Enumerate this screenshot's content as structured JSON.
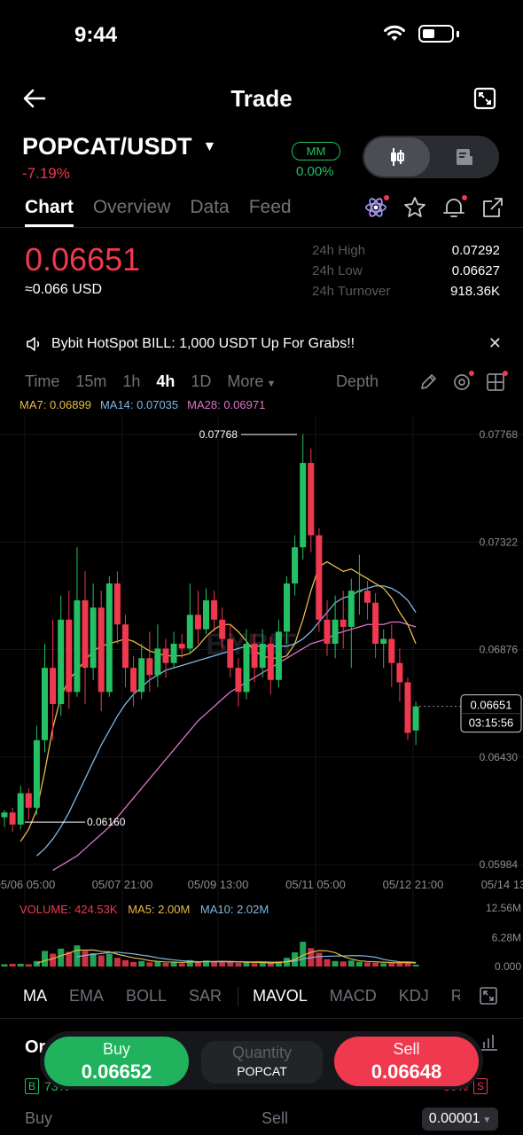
{
  "status_bar": {
    "time": "9:44"
  },
  "header": {
    "title": "Trade"
  },
  "pair": {
    "symbol": "POPCAT/USDT",
    "change": "-7.19%",
    "mm_label": "MM",
    "mm_value": "0.00%"
  },
  "tabs": [
    "Chart",
    "Overview",
    "Data",
    "Feed"
  ],
  "price": {
    "last": "0.06651",
    "usd": "≈0.066 USD"
  },
  "stats": [
    {
      "label": "24h High",
      "value": "0.07292"
    },
    {
      "label": "24h Low",
      "value": "0.06627"
    },
    {
      "label": "24h Turnover",
      "value": "918.36K"
    }
  ],
  "announcement": {
    "text": "Bybit HotSpot BILL: 1,000 USDT Up For Grabs!!"
  },
  "timeframes": {
    "items": [
      "Time",
      "15m",
      "1h",
      "4h",
      "1D"
    ],
    "active": "4h",
    "more": "More",
    "depth": "Depth"
  },
  "ma_legend": {
    "ma7": "MA7: 0.06899",
    "ma14": "MA14: 0.07035",
    "ma28": "MA28: 0.06971"
  },
  "colors": {
    "up": "#24c064",
    "down": "#f0394e",
    "ma7": "#e9b949",
    "ma14": "#7fb8e6",
    "ma28": "#dc74c7"
  },
  "chart_data": {
    "type": "candlestick",
    "y_labels": [
      "0.07768",
      "0.07322",
      "0.06876",
      "0.06430",
      "0.05984"
    ],
    "ylim": [
      0.05984,
      0.07768
    ],
    "x_labels": [
      "05/06 05:00",
      "05/07 21:00",
      "05/09 13:00",
      "05/11 05:00",
      "05/12 21:00",
      "05/14 13"
    ],
    "annotations": {
      "high": "0.07768",
      "low": "0.06160"
    },
    "current": {
      "price": "0.06651",
      "countdown": "03:15:56"
    },
    "candles": [
      [
        0.0618,
        0.062,
        0.0614,
        0.0621
      ],
      [
        0.062,
        0.0615,
        0.0612,
        0.0622
      ],
      [
        0.0615,
        0.0628,
        0.0613,
        0.0631
      ],
      [
        0.0628,
        0.0622,
        0.0617,
        0.063
      ],
      [
        0.0622,
        0.065,
        0.0619,
        0.0656
      ],
      [
        0.065,
        0.068,
        0.0645,
        0.069
      ],
      [
        0.068,
        0.0665,
        0.065,
        0.07
      ],
      [
        0.0665,
        0.07,
        0.066,
        0.071
      ],
      [
        0.07,
        0.067,
        0.0663,
        0.0712
      ],
      [
        0.067,
        0.0708,
        0.0668,
        0.073
      ],
      [
        0.0708,
        0.068,
        0.0665,
        0.072
      ],
      [
        0.068,
        0.0705,
        0.0675,
        0.0715
      ],
      [
        0.0705,
        0.067,
        0.0662,
        0.0712
      ],
      [
        0.067,
        0.0715,
        0.0668,
        0.0718
      ],
      [
        0.0715,
        0.0698,
        0.069,
        0.072
      ],
      [
        0.0698,
        0.068,
        0.0672,
        0.0702
      ],
      [
        0.068,
        0.067,
        0.0664,
        0.0685
      ],
      [
        0.067,
        0.0684,
        0.0667,
        0.069
      ],
      [
        0.0684,
        0.0677,
        0.067,
        0.0695
      ],
      [
        0.0677,
        0.0688,
        0.0672,
        0.0698
      ],
      [
        0.0688,
        0.0682,
        0.0676,
        0.0692
      ],
      [
        0.0682,
        0.069,
        0.068,
        0.0695
      ],
      [
        0.069,
        0.0688,
        0.0684,
        0.0694
      ],
      [
        0.0688,
        0.0702,
        0.0686,
        0.0715
      ],
      [
        0.0702,
        0.0696,
        0.069,
        0.0712
      ],
      [
        0.0696,
        0.0708,
        0.0694,
        0.0713
      ],
      [
        0.0708,
        0.07,
        0.0695,
        0.0712
      ],
      [
        0.07,
        0.0692,
        0.0688,
        0.0705
      ],
      [
        0.0692,
        0.068,
        0.0676,
        0.0698
      ],
      [
        0.068,
        0.067,
        0.0664,
        0.0684
      ],
      [
        0.067,
        0.069,
        0.0667,
        0.0696
      ],
      [
        0.069,
        0.068,
        0.0674,
        0.0694
      ],
      [
        0.068,
        0.069,
        0.0676,
        0.0696
      ],
      [
        0.069,
        0.0675,
        0.0669,
        0.0693
      ],
      [
        0.0675,
        0.0695,
        0.0672,
        0.07
      ],
      [
        0.0695,
        0.0715,
        0.069,
        0.0718
      ],
      [
        0.0715,
        0.073,
        0.071,
        0.0735
      ],
      [
        0.073,
        0.0765,
        0.0725,
        0.0777
      ],
      [
        0.0765,
        0.0735,
        0.0728,
        0.0771
      ],
      [
        0.0735,
        0.07,
        0.0695,
        0.0738
      ],
      [
        0.07,
        0.069,
        0.0685,
        0.0708
      ],
      [
        0.069,
        0.07,
        0.0684,
        0.071
      ],
      [
        0.07,
        0.0697,
        0.0688,
        0.0712
      ],
      [
        0.0697,
        0.0712,
        0.068,
        0.0717
      ],
      [
        0.0712,
        0.0712,
        0.0702,
        0.0727
      ],
      [
        0.0712,
        0.0707,
        0.07,
        0.0716
      ],
      [
        0.0707,
        0.069,
        0.0684,
        0.0711
      ],
      [
        0.069,
        0.0692,
        0.068,
        0.0696
      ],
      [
        0.0692,
        0.0682,
        0.0672,
        0.0698
      ],
      [
        0.0682,
        0.0674,
        0.0666,
        0.0688
      ],
      [
        0.0674,
        0.0653,
        0.065,
        0.0676
      ],
      [
        0.0654,
        0.0664,
        0.0648,
        0.0666
      ]
    ],
    "ma7": [
      0.0608,
      0.0613,
      0.0621,
      0.0637,
      0.0655,
      0.0668,
      0.0675,
      0.0679,
      0.0683,
      0.0687,
      0.0689,
      0.069,
      0.0691,
      0.0692,
      0.0691,
      0.0689,
      0.0687,
      0.0686,
      0.0685,
      0.0685,
      0.0685,
      0.0686,
      0.0689,
      0.0693,
      0.0696,
      0.0698,
      0.0698,
      0.0695,
      0.0691,
      0.0687,
      0.0685,
      0.0684,
      0.0684,
      0.0685,
      0.069,
      0.07,
      0.0712,
      0.0722,
      0.0724,
      0.0722,
      0.072,
      0.0721,
      0.0719,
      0.0717,
      0.0715,
      0.0713,
      0.0709,
      0.0703,
      0.0698,
      0.069
    ],
    "ma14": [
      0.0602,
      0.0605,
      0.0609,
      0.0614,
      0.062,
      0.0627,
      0.0634,
      0.0641,
      0.0648,
      0.0654,
      0.066,
      0.0665,
      0.0669,
      0.0672,
      0.0675,
      0.0677,
      0.0679,
      0.068,
      0.0681,
      0.0682,
      0.0683,
      0.0684,
      0.0685,
      0.0686,
      0.0687,
      0.0688,
      0.0689,
      0.0689,
      0.0689,
      0.0689,
      0.0689,
      0.0689,
      0.069,
      0.0692,
      0.0695,
      0.0699,
      0.0703,
      0.0707,
      0.0709,
      0.071,
      0.0712,
      0.0713,
      0.0714,
      0.0714,
      0.0713,
      0.0711,
      0.0708,
      0.0703
    ],
    "ma28": [
      0.0596,
      0.0598,
      0.06,
      0.0602,
      0.0605,
      0.0608,
      0.0611,
      0.0614,
      0.0618,
      0.0622,
      0.0626,
      0.063,
      0.0634,
      0.0638,
      0.0642,
      0.0646,
      0.065,
      0.0654,
      0.0658,
      0.0661,
      0.0664,
      0.0667,
      0.067,
      0.0672,
      0.0674,
      0.0676,
      0.0678,
      0.068,
      0.0682,
      0.0684,
      0.0686,
      0.0688,
      0.069,
      0.0691,
      0.0692,
      0.0694,
      0.0695,
      0.0696,
      0.0697,
      0.0698,
      0.0698,
      0.0698,
      0.0699,
      0.0699,
      0.0698,
      0.0697
    ]
  },
  "volume_legend": {
    "volume": "VOLUME: 424.53K",
    "ma5": "MA5: 2.00M",
    "ma10": "MA10: 2.02M"
  },
  "volume_axis": [
    "12.56M",
    "6.28M",
    "0.000"
  ],
  "volume_values": [
    0.5,
    0.6,
    0.6,
    0.5,
    1.2,
    3.4,
    2.8,
    3.9,
    3.2,
    4.6,
    3.4,
    2.9,
    2.4,
    2.8,
    1.9,
    1.4,
    1.0,
    1.2,
    0.9,
    1.1,
    0.8,
    0.9,
    0.7,
    1.4,
    1.1,
    1.3,
    1.0,
    0.9,
    1.2,
    0.8,
    0.9,
    0.7,
    0.8,
    0.7,
    1.1,
    1.9,
    3.1,
    5.4,
    4.0,
    3.0,
    1.6,
    1.2,
    1.1,
    1.3,
    1.0,
    0.9,
    0.8,
    0.7,
    0.9,
    0.8,
    1.1,
    0.4
  ],
  "indicators": {
    "items": [
      "MA",
      "EMA",
      "BOLL",
      "SAR",
      "MAVOL",
      "MACD",
      "KDJ",
      "R"
    ],
    "active": [
      "MA",
      "MAVOL"
    ]
  },
  "bottom": {
    "order_peek": "Or",
    "buy_label": "Buy",
    "buy_price": "0.06652",
    "qty_label": "Quantity",
    "qty_unit": "POPCAT",
    "sell_label": "Sell",
    "sell_price": "0.06648",
    "buy_chip": "B",
    "sell_chip": "S",
    "left_pct": "73%",
    "right_pct": "30%",
    "foot_buy": "Buy",
    "foot_sell": "Sell",
    "tick": "0.00001"
  }
}
